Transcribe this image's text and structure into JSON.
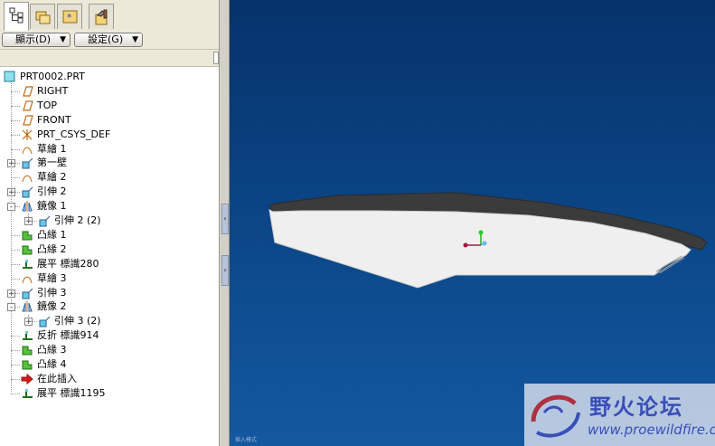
{
  "tabs": [
    {
      "name": "model-tree-tab",
      "icon": "model-tree-icon"
    },
    {
      "name": "folder-browser-tab",
      "icon": "folder-icon"
    },
    {
      "name": "favorites-tab",
      "icon": "favorites-icon"
    },
    {
      "name": "connections-tab",
      "icon": "tools-icon"
    }
  ],
  "toolbar": {
    "display_label": "顯示(D)",
    "settings_label": "設定(G)"
  },
  "tree": {
    "items": [
      {
        "label": "PRT0002.PRT",
        "icon": "part-icon",
        "level": 0,
        "expander": ""
      },
      {
        "label": "RIGHT",
        "icon": "datum-plane-icon",
        "level": 1,
        "expander": ""
      },
      {
        "label": "TOP",
        "icon": "datum-plane-icon",
        "level": 1,
        "expander": ""
      },
      {
        "label": "FRONT",
        "icon": "datum-plane-icon",
        "level": 1,
        "expander": ""
      },
      {
        "label": "PRT_CSYS_DEF",
        "icon": "csys-icon",
        "level": 1,
        "expander": ""
      },
      {
        "label": "草繪 1",
        "icon": "sketch-icon",
        "level": 1,
        "expander": ""
      },
      {
        "label": "第一壁",
        "icon": "extrude-wall-icon",
        "level": 1,
        "expander": "+"
      },
      {
        "label": "草繪 2",
        "icon": "sketch-icon",
        "level": 1,
        "expander": ""
      },
      {
        "label": "引伸 2",
        "icon": "extrude-icon",
        "level": 1,
        "expander": "+"
      },
      {
        "label": "鏡像 1",
        "icon": "mirror-icon",
        "level": 1,
        "expander": "-"
      },
      {
        "label": "引伸 2 (2)",
        "icon": "extrude-icon",
        "level": 2,
        "expander": "+"
      },
      {
        "label": "凸緣 1",
        "icon": "flange-icon",
        "level": 1,
        "expander": ""
      },
      {
        "label": "凸緣 2",
        "icon": "flange-icon",
        "level": 1,
        "expander": ""
      },
      {
        "label": "展平 標識280",
        "icon": "unbend-icon",
        "level": 1,
        "expander": ""
      },
      {
        "label": "草繪 3",
        "icon": "sketch-icon",
        "level": 1,
        "expander": ""
      },
      {
        "label": "引伸 3",
        "icon": "extrude-icon",
        "level": 1,
        "expander": "+"
      },
      {
        "label": "鏡像 2",
        "icon": "mirror-icon",
        "level": 1,
        "expander": "-"
      },
      {
        "label": "引伸 3 (2)",
        "icon": "extrude-icon",
        "level": 2,
        "expander": "+"
      },
      {
        "label": "反折 標識914",
        "icon": "bendback-icon",
        "level": 1,
        "expander": ""
      },
      {
        "label": "凸緣 3",
        "icon": "flange-icon",
        "level": 1,
        "expander": ""
      },
      {
        "label": "凸緣 4",
        "icon": "flange-icon",
        "level": 1,
        "expander": ""
      },
      {
        "label": "在此插入",
        "icon": "insert-here-arrow-icon",
        "level": 1,
        "expander": ""
      },
      {
        "label": "展平 標識1195",
        "icon": "unbend-icon",
        "level": 1,
        "expander": ""
      }
    ]
  },
  "viewport": {
    "status_text": "插入模式"
  },
  "watermark": {
    "name_cn": "野火论坛",
    "url": "www.proewildfire.cn"
  },
  "colors": {
    "viewport_top": "#06326b",
    "viewport_bottom": "#1458a0",
    "part_face": "#efefef",
    "part_edge": "#3c3c3c"
  }
}
